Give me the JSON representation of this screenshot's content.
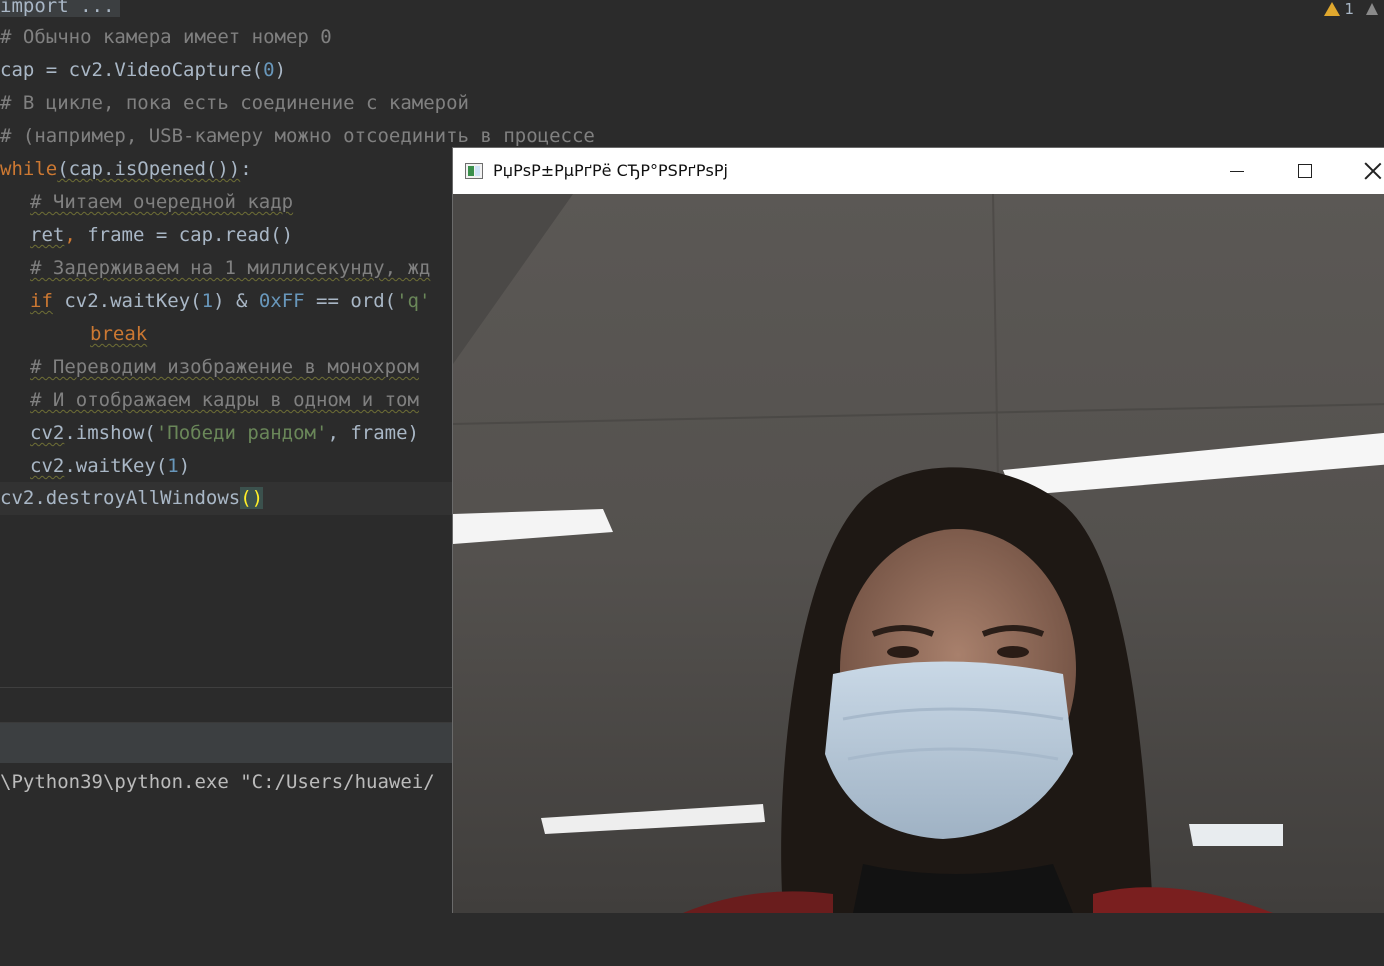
{
  "editor": {
    "warning_count": "1",
    "lines": {
      "l0": "import ...",
      "l1": "# Обычно камера имеет номер 0",
      "l2_a": "cap = cv2.VideoCapture(",
      "l2_b": "0",
      "l2_c": ")",
      "l3": "# В цикле, пока есть соединение с камерой",
      "l4": "# (например, USB-камеру можно отсоединить в процессе",
      "l5_kw": "while",
      "l5_a": "(cap.isOpened())",
      "l5_b": ":",
      "l6": "# Читаем очередной кадр",
      "l7_a": "ret",
      "l7_b": ",",
      "l7_c": " frame = cap.read()",
      "l8": "# Задерживаем на 1 миллисекунду, жд",
      "l9_kw": "if",
      "l9_a": " cv2.waitKey(",
      "l9_b": "1",
      "l9_c": ") & ",
      "l9_d": "0xFF",
      "l9_e": " == ord(",
      "l9_f": "'q'",
      "l10": "break",
      "l11": "# Переводим изображение в монохром",
      "l12": "# И отображаем кадры в одном и том",
      "l13_a": "cv2",
      "l13_b": ".imshow(",
      "l13_c": "'Победи рандом'",
      "l13_d": ", frame)",
      "l14_a": "cv2",
      "l14_b": ".waitKey(",
      "l14_c": "1",
      "l14_d": ")",
      "l15_a": "cv2.destroyAllWindows",
      "l15_b": "()"
    }
  },
  "console": {
    "command": "\\Python39\\python.exe \"C:/Users/huawei/"
  },
  "video_window": {
    "title": "РџРѕР±РµРґРё СЂР°РЅРґРѕРј",
    "minimize_icon": "minimize-icon",
    "maximize_icon": "maximize-icon",
    "close_icon": "close-icon"
  }
}
